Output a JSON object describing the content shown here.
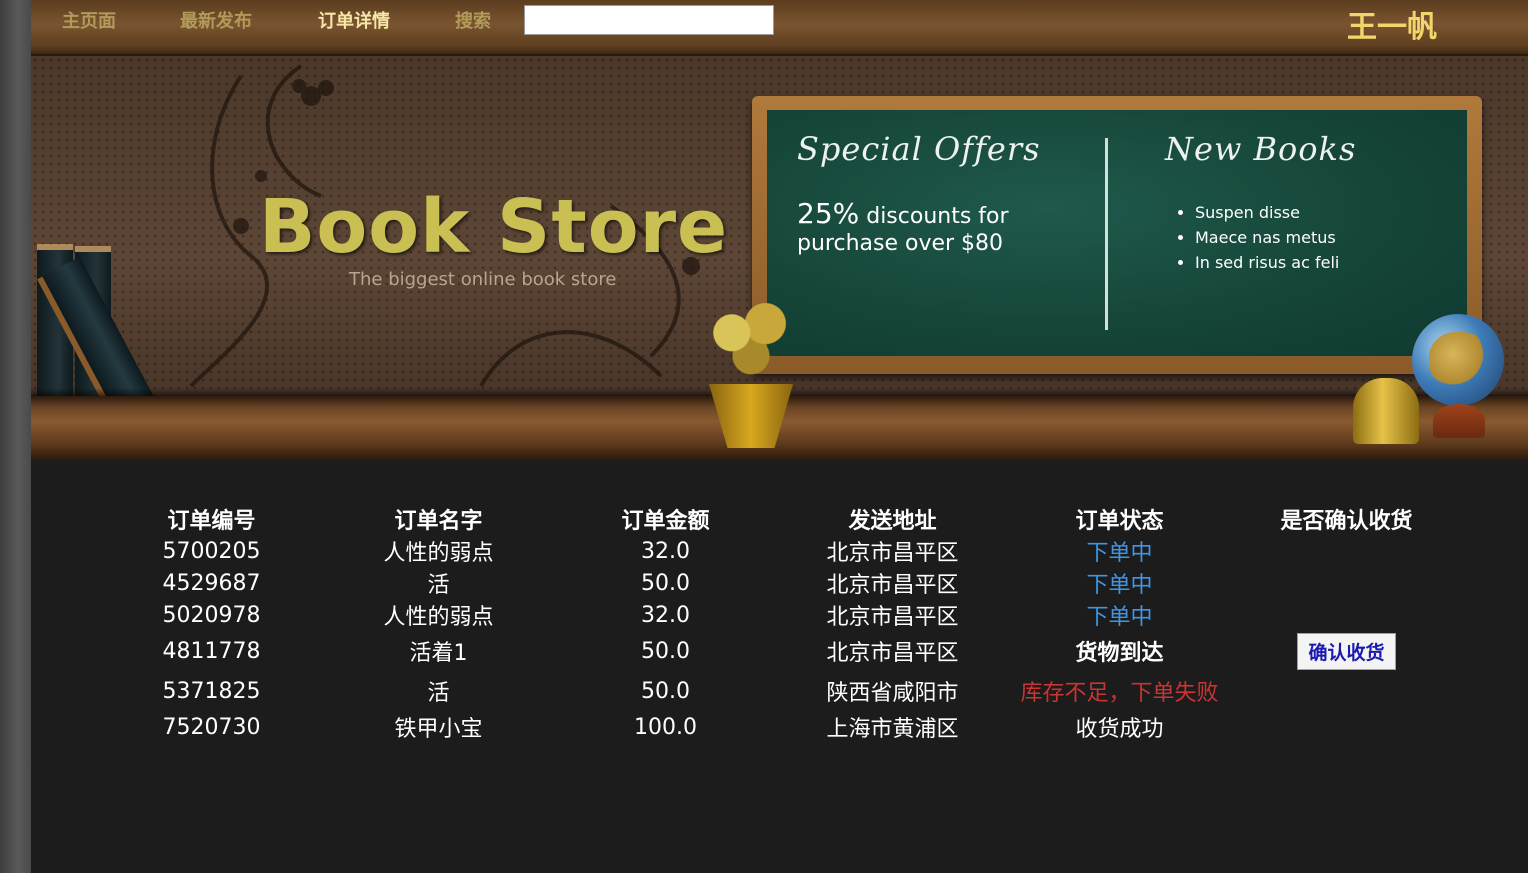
{
  "nav": {
    "items": [
      {
        "label": "主页面",
        "active": false
      },
      {
        "label": "最新发布",
        "active": false
      },
      {
        "label": "订单详情",
        "active": true
      },
      {
        "label": "搜索",
        "active": false
      }
    ],
    "search_value": "",
    "user_name": "王一帆"
  },
  "banner": {
    "title": "Book Store",
    "subtitle": "The biggest online book store",
    "board": {
      "left_heading": "Special Offers",
      "offer_line1_big": "25%",
      "offer_line1_rest": "discounts for",
      "offer_line2": "purchase over $80",
      "right_heading": "New Books",
      "new_books": [
        "Suspen disse",
        "Maece nas metus",
        "In sed risus ac feli"
      ]
    }
  },
  "orders": {
    "headers": [
      "订单编号",
      "订单名字",
      "订单金额",
      "发送地址",
      "订单状态",
      "是否确认收货"
    ],
    "rows": [
      {
        "id": "5700205",
        "name": "人性的弱点",
        "amount": "32.0",
        "address": "北京市昌平区",
        "status": "下单中",
        "status_type": "link",
        "confirm": ""
      },
      {
        "id": "4529687",
        "name": "活",
        "amount": "50.0",
        "address": "北京市昌平区",
        "status": "下单中",
        "status_type": "link",
        "confirm": ""
      },
      {
        "id": "5020978",
        "name": "人性的弱点",
        "amount": "32.0",
        "address": "北京市昌平区",
        "status": "下单中",
        "status_type": "link",
        "confirm": ""
      },
      {
        "id": "4811778",
        "name": "活着1",
        "amount": "50.0",
        "address": "北京市昌平区",
        "status": "货物到达",
        "status_type": "bold",
        "confirm": "确认收货"
      },
      {
        "id": "5371825",
        "name": "活",
        "amount": "50.0",
        "address": "陕西省咸阳市",
        "status": "库存不足，下单失败",
        "status_type": "fail",
        "confirm": ""
      },
      {
        "id": "7520730",
        "name": "铁甲小宝",
        "amount": "100.0",
        "address": "上海市黄浦区",
        "status": "收货成功",
        "status_type": "plain",
        "confirm": ""
      }
    ]
  },
  "colors": {
    "nav_text": "#b19a5a",
    "nav_active": "#f6e7a8",
    "user_name": "#f3d66b",
    "status_link": "#3d97e8",
    "status_fail": "#cc3333",
    "page_bg": "#1c1c1c"
  }
}
